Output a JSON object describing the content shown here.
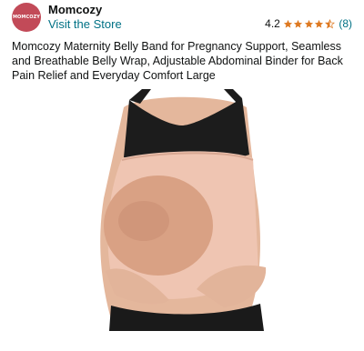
{
  "seller": {
    "logo_text": "MOMCOZY",
    "name": "Momcozy",
    "visit_store_label": "Visit the Store"
  },
  "rating": {
    "value": "4.2",
    "stars": 4.2,
    "review_count": "(8)",
    "star_color": "#de7921"
  },
  "product": {
    "title": "Momcozy Maternity Belly Band for Pregnancy Support, Seamless and Breathable Belly Wrap, Adjustable Abdominal Binder for Back Pain Relief and Everyday Comfort Large"
  },
  "colors": {
    "link": "#007185",
    "brand": "#c24a58"
  }
}
